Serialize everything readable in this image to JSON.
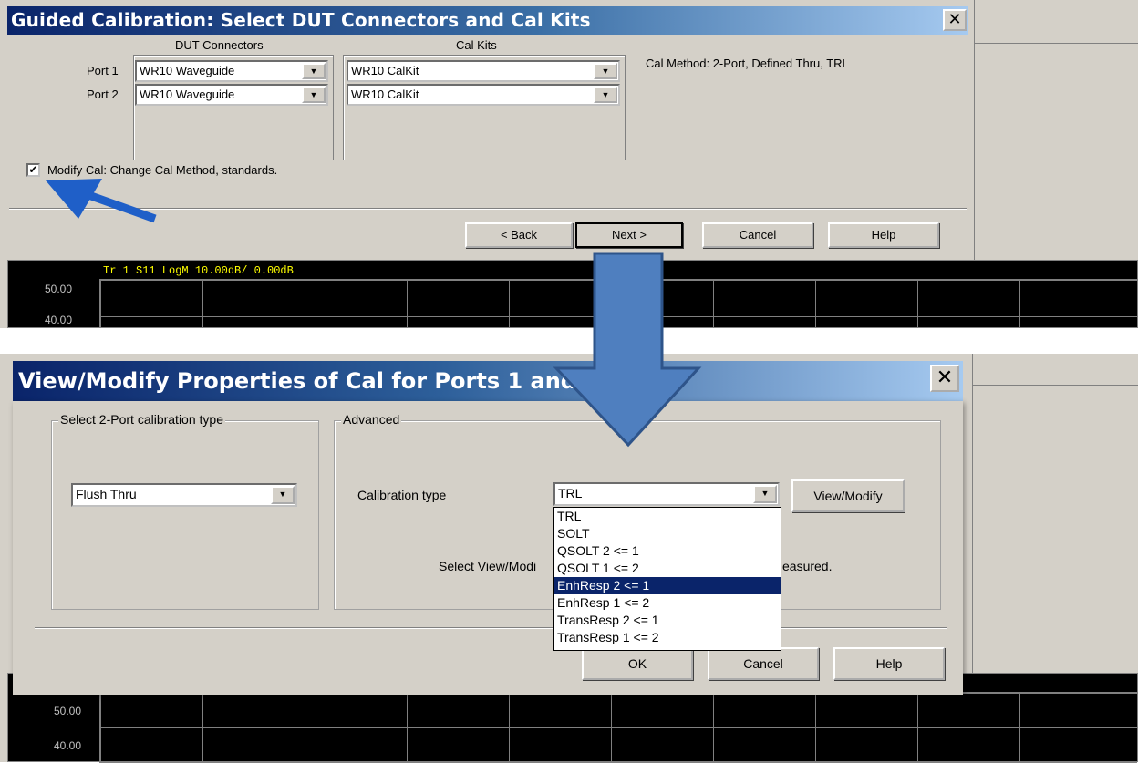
{
  "guided_dialog": {
    "title": "Guided Calibration: Select DUT Connectors and Cal Kits",
    "close_glyph": "✕",
    "dut_connectors_header": "DUT Connectors",
    "cal_kits_header": "Cal Kits",
    "ports": [
      {
        "label": "Port 1",
        "connector": "WR10 Waveguide",
        "calkit": "WR10 CalKit"
      },
      {
        "label": "Port 2",
        "connector": "WR10 Waveguide",
        "calkit": "WR10 CalKit"
      }
    ],
    "cal_method": "Cal Method:  2-Port, Defined Thru, TRL",
    "modify_cal_checkbox": {
      "label": "Modify Cal: Change Cal Method, standards.",
      "checked": true,
      "glyph": "✔"
    },
    "buttons": {
      "back": "< Back",
      "next": "Next >",
      "cancel": "Cancel",
      "help": "Help"
    }
  },
  "trace_top": {
    "label": "Tr 1   S11 LogM 10.00dB/  0.00dB",
    "y_ticks": [
      "50.00",
      "40.00"
    ]
  },
  "modify_dialog": {
    "title": "View/Modify Properties of Cal for Ports 1 and 2",
    "close_glyph": "✕",
    "left_group_label": "Select 2-Port calibration type",
    "thru_type": "Flush Thru",
    "advanced_label": "Advanced",
    "calibration_type_label": "Calibration type",
    "calibration_type_value": "TRL",
    "view_modify_button": "View/Modify",
    "hint_text_left": "Select View/Modi",
    "hint_text_right": "easured.",
    "dropdown_options": [
      "TRL",
      "SOLT",
      "QSOLT 2 <= 1",
      "QSOLT 1 <= 2",
      "EnhResp 2 <= 1",
      "EnhResp 1 <= 2",
      "TransResp 2 <= 1",
      "TransResp 1 <= 2"
    ],
    "dropdown_highlighted": "EnhResp 2 <= 1",
    "buttons": {
      "ok": "OK",
      "cancel": "Cancel",
      "help": "Help"
    }
  },
  "trace_bottom": {
    "y_ticks": [
      "50.00",
      "40.00"
    ]
  },
  "colors": {
    "annotation_arrow": "#1f5fc8",
    "big_arrow": "#4f7fbf",
    "title_dark": "#0a246a",
    "title_light": "#a6caf0",
    "trace_label": "#ffff00"
  },
  "icons": {
    "dropdown": "triangle-down",
    "close": "x-mark",
    "checkbox": "check-mark",
    "annotation": "diagonal-arrow",
    "transition": "big-down-arrow"
  }
}
